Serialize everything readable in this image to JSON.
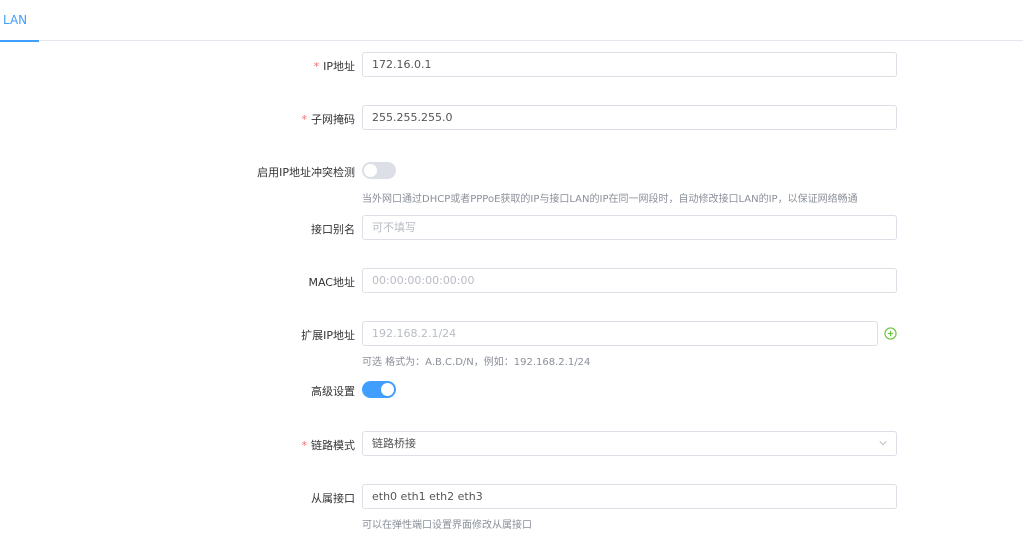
{
  "tabs": [
    {
      "label": "LAN"
    }
  ],
  "form": {
    "ip": {
      "label": "IP地址",
      "value": "172.16.0.1"
    },
    "netmask": {
      "label": "子网掩码",
      "value": "255.255.255.0"
    },
    "ip_conflict": {
      "label": "启用IP地址冲突检测",
      "enabled": false,
      "hint": "当外网口通过DHCP或者PPPoE获取的IP与接口LAN的IP在同一网段时，自动修改接口LAN的IP，以保证网络畅通"
    },
    "alias": {
      "label": "接口别名",
      "placeholder": "可不填写"
    },
    "mac": {
      "label": "MAC地址",
      "placeholder": "00:00:00:00:00:00"
    },
    "ext_ip": {
      "label": "扩展IP地址",
      "placeholder": "192.168.2.1/24",
      "hint": "可选 格式为：A.B.C.D/N，例如：192.168.2.1/24"
    },
    "advanced": {
      "label": "高级设置",
      "enabled": true
    },
    "link_mode": {
      "label": "链路模式",
      "value": "链路桥接"
    },
    "slave_ports": {
      "label": "从属接口",
      "value": "eth0 eth1 eth2 eth3",
      "hint": "可以在弹性端口设置界面修改从属接口"
    }
  },
  "colors": {
    "accent": "#409eff",
    "required": "#f56c6c",
    "switch_off": "#dcdfe6",
    "add_icon": "#67c23a"
  },
  "icons": {
    "dropdown": "chevron-down-icon",
    "add": "plus-circle-icon"
  }
}
